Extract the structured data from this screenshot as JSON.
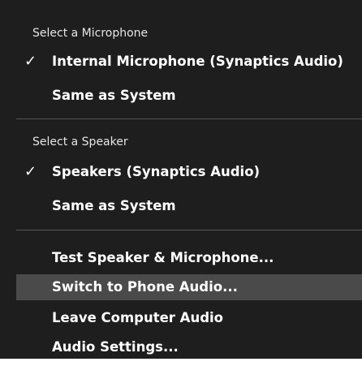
{
  "microphone_section": {
    "header": "Select a Microphone",
    "items": [
      {
        "label": "Internal Microphone (Synaptics Audio)",
        "checked": true
      },
      {
        "label": "Same as System",
        "checked": false
      }
    ]
  },
  "speaker_section": {
    "header": "Select a Speaker",
    "items": [
      {
        "label": "Speakers (Synaptics Audio)",
        "checked": true
      },
      {
        "label": "Same as System",
        "checked": false
      }
    ]
  },
  "actions": [
    {
      "label": "Test Speaker & Microphone..."
    },
    {
      "label": "Switch to Phone Audio..."
    },
    {
      "label": "Leave Computer Audio"
    },
    {
      "label": "Audio Settings..."
    }
  ],
  "check_glyph": "✓",
  "colors": {
    "background": "#1e1e1e",
    "hover": "#4a4a4a",
    "text": "#ffffff",
    "divider": "#555555"
  }
}
